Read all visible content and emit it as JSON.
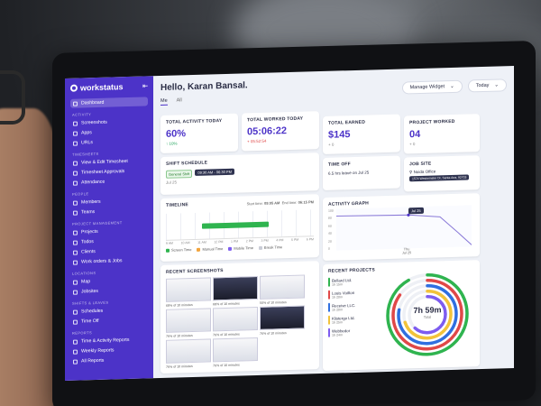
{
  "sidebar": {
    "brand": "workstatus",
    "collapse_icon": "collapse-icon",
    "sections": [
      {
        "title": "",
        "items": [
          {
            "label": "Dashboard",
            "icon": "dashboard-icon",
            "active": true
          }
        ]
      },
      {
        "title": "ACTIVITY",
        "items": [
          {
            "label": "Screenshots",
            "icon": "camera-icon"
          },
          {
            "label": "Apps",
            "icon": "apps-icon"
          },
          {
            "label": "URLs",
            "icon": "link-icon"
          }
        ]
      },
      {
        "title": "TIMESHEETS",
        "items": [
          {
            "label": "View & Edit Timesheet",
            "icon": "timesheet-icon"
          },
          {
            "label": "Timesheet Approvals",
            "icon": "approval-icon"
          },
          {
            "label": "Attendance",
            "icon": "calendar-icon"
          }
        ]
      },
      {
        "title": "PEOPLE",
        "items": [
          {
            "label": "Members",
            "icon": "members-icon"
          },
          {
            "label": "Teams",
            "icon": "teams-icon"
          }
        ]
      },
      {
        "title": "PROJECT MANAGEMENT",
        "items": [
          {
            "label": "Projects",
            "icon": "projects-icon"
          },
          {
            "label": "Todos",
            "icon": "todo-icon"
          },
          {
            "label": "Clients",
            "icon": "clients-icon"
          },
          {
            "label": "Work orders & Jobs",
            "icon": "workorder-icon"
          }
        ]
      },
      {
        "title": "LOCATIONS",
        "items": [
          {
            "label": "Map",
            "icon": "map-icon"
          },
          {
            "label": "Jobsites",
            "icon": "jobsite-icon"
          }
        ]
      },
      {
        "title": "SHIFTS & LEAVES",
        "items": [
          {
            "label": "Schedules",
            "icon": "schedule-icon"
          },
          {
            "label": "Time Off",
            "icon": "timeoff-icon"
          }
        ]
      },
      {
        "title": "REPORTS",
        "items": [
          {
            "label": "Time & Activity Reports",
            "icon": "report-icon"
          },
          {
            "label": "Weekly Reports",
            "icon": "weekly-icon"
          },
          {
            "label": "All Reports",
            "icon": "all-reports-icon"
          }
        ]
      }
    ]
  },
  "header": {
    "greeting": "Hello, Karan Bansal.",
    "tabs": [
      "Me",
      "All"
    ],
    "manage_widget": "Manage Widget",
    "date_range": "Today"
  },
  "stats": {
    "activity": {
      "title": "TOTAL ACTIVITY TODAY",
      "value": "60%",
      "delta": "↑ 10%"
    },
    "worked": {
      "title": "TOTAL WORKED TODAY",
      "value": "05:06:22",
      "delta": "+ 05:52:54"
    },
    "earned": {
      "title": "TOTAL EARNED",
      "value": "$145",
      "delta": "+ 0"
    },
    "project": {
      "title": "PROJECT WORKED",
      "value": "04",
      "delta": "+ 0"
    }
  },
  "shift": {
    "title": "SHIFT SCHEDULE",
    "chip": "General Shift",
    "tip": "09:30 AM - 06:30 PM",
    "date_label": "Jul 25"
  },
  "timeoff": {
    "title": "TIME OFF",
    "text": "6.5 hrs leave on Jul 25"
  },
  "jobsite": {
    "title": "JOB SITE",
    "pin": "Noida Office",
    "address": "1574 Westminster Dr, Santa Ana, 92703"
  },
  "timeline": {
    "title": "TIMELINE",
    "start_label": "Start time:",
    "start": "09:05 AM",
    "end_label": "End time:",
    "end": "06:15 PM",
    "legend": [
      "Screen Time",
      "Manual Time",
      "Mobile Time",
      "Break Time"
    ],
    "legend_colors": [
      "#2fb44f",
      "#f2a33a",
      "#7d5cf0",
      "#c9ccd6"
    ],
    "ticks": [
      "9 AM",
      "10 AM",
      "11 AM",
      "12 PM",
      "1 PM",
      "2 PM",
      "3 PM",
      "4 PM",
      "5 PM",
      "6 PM"
    ]
  },
  "activity_graph": {
    "title": "ACTIVITY GRAPH",
    "yticks": [
      "100",
      "80",
      "60",
      "40",
      "20",
      "0"
    ],
    "tip": "Jul 25",
    "xlabel": "Thu",
    "xsub": "Jul 25"
  },
  "screenshots": {
    "title": "RECENT SCREENSHOTS",
    "items": [
      {
        "label": "68% of 10 minutes",
        "dark": false
      },
      {
        "label": "68% of 10 minutes",
        "dark": true
      },
      {
        "label": "50% of 10 minutes",
        "dark": false
      },
      {
        "label": "76% of 10 minutes",
        "dark": false
      },
      {
        "label": "76% of 10 minutes",
        "dark": false
      },
      {
        "label": "76% of 10 minutes",
        "dark": true
      },
      {
        "label": "76% of 10 minutes",
        "dark": false
      },
      {
        "label": "76% of 10 minutes",
        "dark": false
      }
    ]
  },
  "recent_projects": {
    "title": "RECENT PROJECTS",
    "items": [
      {
        "name": "Bellard Ltd.",
        "time": "1h 15m",
        "color": "#2fb44f"
      },
      {
        "name": "Louis Vuitton",
        "time": "1h 20m",
        "color": "#e04848"
      },
      {
        "name": "Receive LLC.",
        "time": "1h 20m",
        "color": "#2f6fe0"
      },
      {
        "name": "Klistergo Ltd.",
        "time": "1h 25m",
        "color": "#f2c33a"
      },
      {
        "name": "Webbedor",
        "time": "1h 24m",
        "color": "#7d5cf0"
      }
    ],
    "donut_total": "7h 59m",
    "donut_label": "Total",
    "donut_fractions": [
      0.92,
      0.85,
      0.78,
      0.7,
      0.62
    ]
  },
  "colors": {
    "brand": "#4c33c8",
    "accent_green": "#2fb44f"
  }
}
